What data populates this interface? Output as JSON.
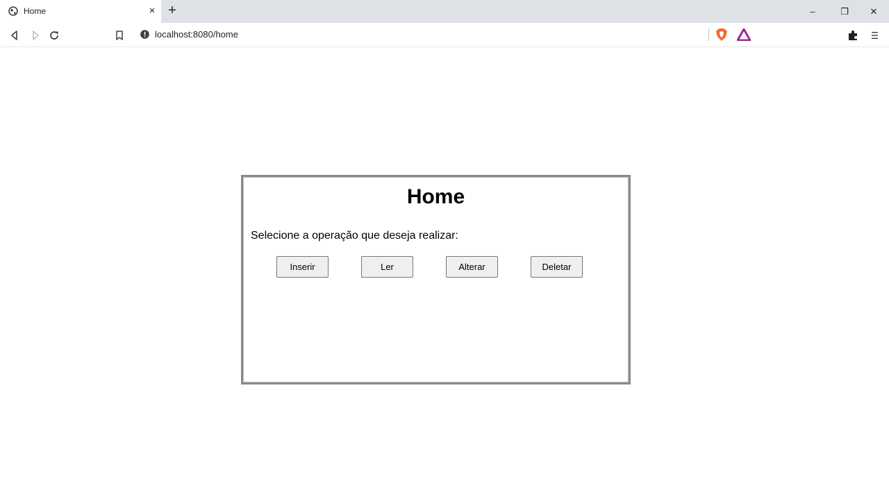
{
  "browser": {
    "tab": {
      "title": "Home",
      "close_glyph": "×"
    },
    "new_tab_glyph": "+",
    "window_controls": {
      "minimize": "–",
      "restore": "❐",
      "close": "✕"
    },
    "address_bar": {
      "url": "localhost:8080/home"
    },
    "icons": {
      "favicon": "globe-icon",
      "back": "back-icon",
      "forward": "forward-icon",
      "reload": "reload-icon",
      "bookmark": "bookmark-icon",
      "site_info": "info-icon",
      "brave_shields": "brave-shield-icon",
      "brave_rewards": "brave-rewards-icon",
      "extensions": "puzzle-icon",
      "menu": "menu-icon"
    },
    "colors": {
      "shield": "#f26a2d",
      "rewards": "#a3278f",
      "tabstrip": "#dee1e6"
    }
  },
  "page": {
    "title": "Home",
    "prompt": "Selecione a operação que deseja realizar:",
    "buttons": [
      "Inserir",
      "Ler",
      "Alterar",
      "Deletar"
    ]
  }
}
